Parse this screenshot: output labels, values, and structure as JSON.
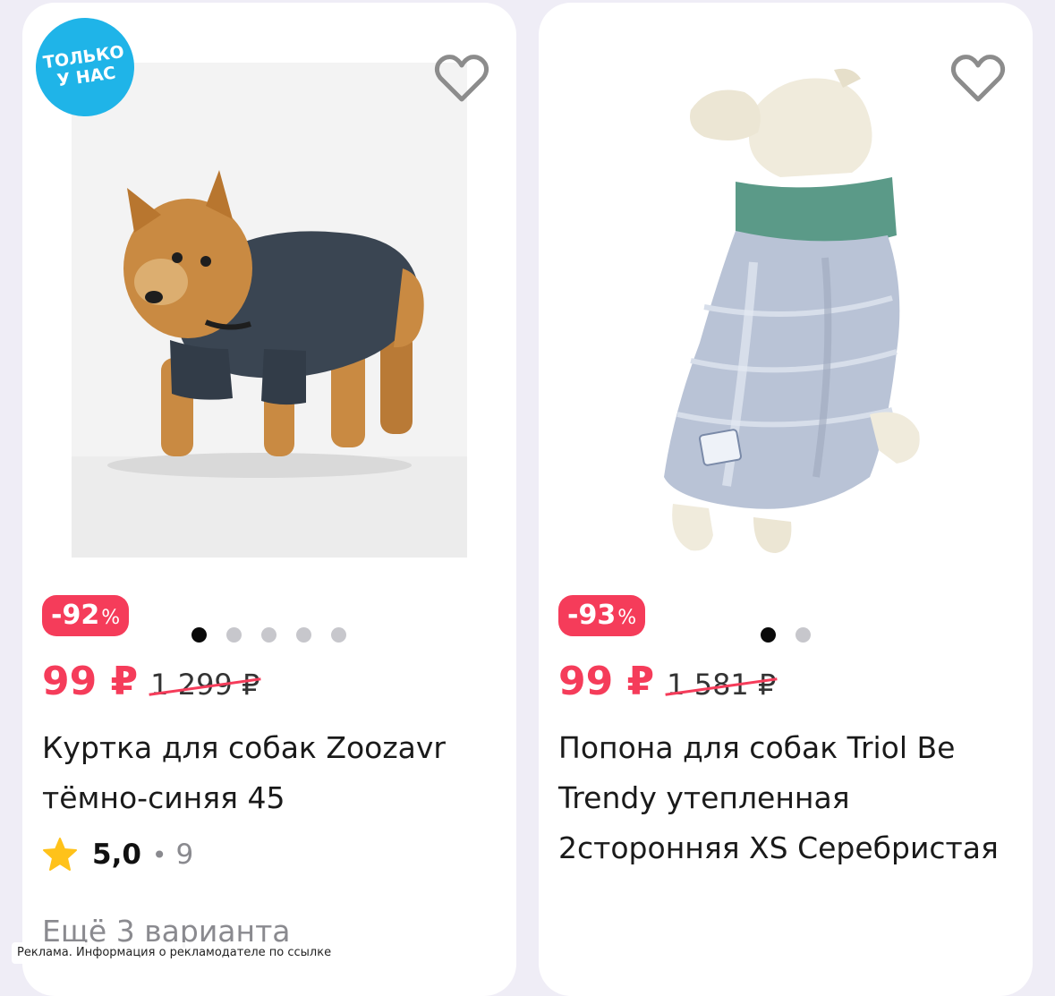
{
  "products": [
    {
      "promo_badge": "ТОЛЬКО\nУ НАС",
      "discount_value": "-92",
      "discount_percent": "%",
      "price": "99 ₽",
      "old_price": "1 299 ₽",
      "title": "Куртка для собак Zoozavr тёмно-синяя 45",
      "rating": "5,0",
      "rating_separator": "•",
      "reviews_count": "9",
      "variants": "Ещё 3 варианта",
      "image_icon": "dog-jacket-photo",
      "gallery_dots": 5,
      "gallery_active_index": 0
    },
    {
      "discount_value": "-93",
      "discount_percent": "%",
      "price": "99 ₽",
      "old_price": "1 581 ₽",
      "title": "Попона для собак Triol Be Trendy утепленная 2сторонняя XS Серебристая",
      "image_icon": "dog-vest-photo",
      "gallery_dots": 2,
      "gallery_active_index": 0
    }
  ],
  "icons": {
    "favorite": "heart-icon",
    "rating": "star-icon"
  },
  "colors": {
    "accent": "#f53c5a",
    "badge": "#1fb4e8",
    "star": "#ffc21a",
    "background": "#efedf6"
  },
  "ad_notice": "Реклама. Информация о рекламодателе по ссылке"
}
